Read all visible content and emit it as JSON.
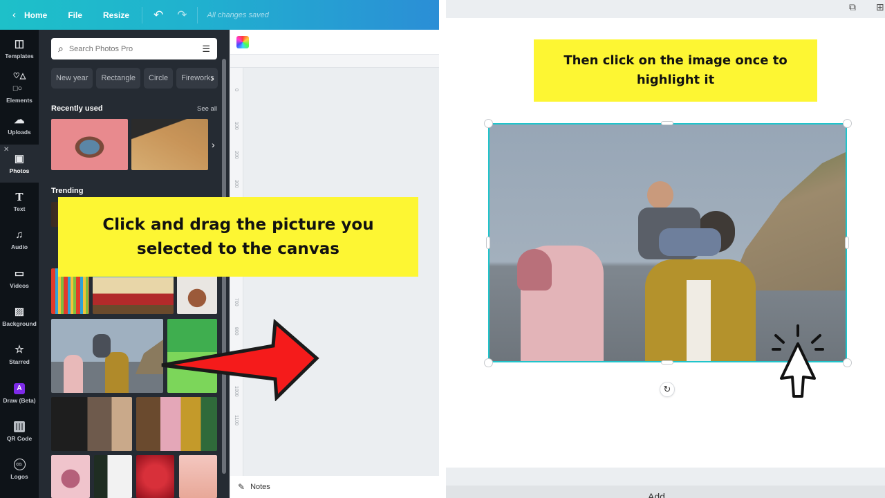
{
  "topbar": {
    "home_label": "Home",
    "file_label": "File",
    "resize_label": "Resize",
    "status": "All changes saved"
  },
  "nav": [
    {
      "label": "Templates",
      "icon": "templates-icon",
      "glyph": "◫"
    },
    {
      "label": "Elements",
      "icon": "elements-icon",
      "glyph": "♡△"
    },
    {
      "label": "Uploads",
      "icon": "upload-cloud-icon",
      "glyph": "☁"
    },
    {
      "label": "Photos",
      "icon": "photos-icon",
      "glyph": "🖼",
      "active": true
    },
    {
      "label": "Text",
      "icon": "text-icon",
      "glyph": "T"
    },
    {
      "label": "Audio",
      "icon": "audio-icon",
      "glyph": "♫"
    },
    {
      "label": "Videos",
      "icon": "videos-icon",
      "glyph": "▭"
    },
    {
      "label": "Background",
      "icon": "background-icon",
      "glyph": "▨"
    },
    {
      "label": "Starred",
      "icon": "star-icon",
      "glyph": "☆"
    },
    {
      "label": "Draw (Beta)",
      "icon": "draw-icon",
      "glyph": "A"
    },
    {
      "label": "QR Code",
      "icon": "qr-code-icon",
      "glyph": ""
    },
    {
      "label": "Logos",
      "icon": "logos-icon",
      "glyph": "CO."
    }
  ],
  "photos_panel": {
    "search_placeholder": "Search Photos Pro",
    "chips": [
      "New year",
      "Rectangle",
      "Circle",
      "Fireworks"
    ],
    "recently_used_title": "Recently used",
    "see_all_label": "See all",
    "trending_title": "Trending"
  },
  "ruler": {
    "ticks": [
      "0",
      "100",
      "200",
      "300",
      "700",
      "800",
      "1000",
      "1100"
    ]
  },
  "notes_label": "Notes",
  "callouts": {
    "left": "Click and drag the picture you selected to the canvas",
    "right": "Then click on the image once to highlight it"
  },
  "right_panel": {
    "add_page_label": "Add"
  },
  "colors": {
    "topbar_start": "#1ec0c9",
    "topbar_end": "#2b8ed6",
    "callout_yellow": "#fdf633",
    "arrow_red": "#f51b1b",
    "selection_teal": "#20c4cb",
    "draw_purple": "#7d2ae8"
  }
}
